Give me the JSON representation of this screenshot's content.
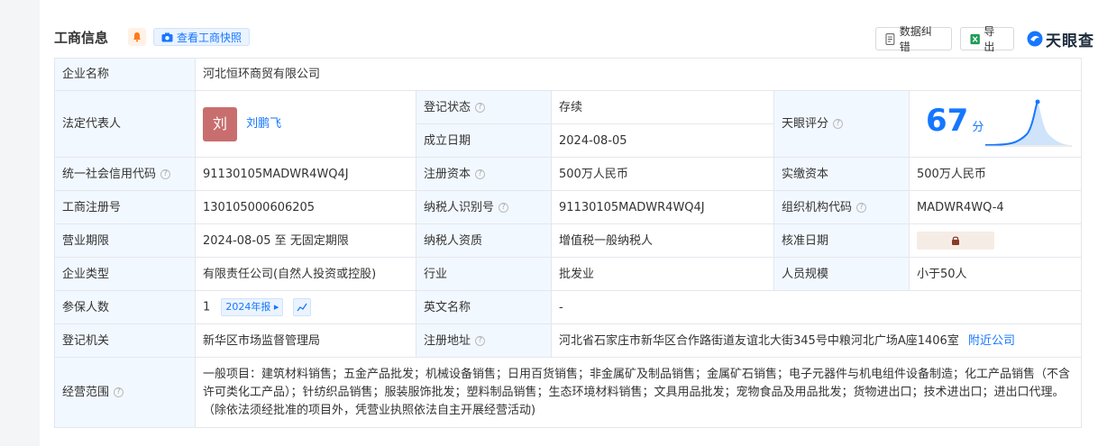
{
  "header": {
    "title": "工商信息",
    "snapshot_label": "查看工商快照",
    "correct_label": "数据纠错",
    "export_label": "导出",
    "brand": "天眼查",
    "accent": "#1677ff"
  },
  "rows": {
    "company_name_label": "企业名称",
    "company_name": "河北恒环商贸有限公司",
    "legal_rep_label": "法定代表人",
    "legal_rep_avatar": "刘",
    "legal_rep_name": "刘鹏飞",
    "reg_status_label": "登记状态",
    "reg_status": "存续",
    "found_date_label": "成立日期",
    "found_date": "2024-08-05",
    "score_label": "天眼评分",
    "score": "67",
    "score_unit": "分",
    "credit_code_label": "统一社会信用代码",
    "credit_code": "91130105MADWR4WQ4J",
    "reg_capital_label": "注册资本",
    "reg_capital": "500万人民币",
    "paid_capital_label": "实缴资本",
    "paid_capital": "500万人民币",
    "biz_reg_no_label": "工商注册号",
    "biz_reg_no": "130105000606205",
    "taxpayer_id_label": "纳税人识别号",
    "taxpayer_id": "91130105MADWR4WQ4J",
    "org_code_label": "组织机构代码",
    "org_code": "MADWR4WQ-4",
    "term_label": "营业期限",
    "term": "2024-08-05 至 无固定期限",
    "taxpayer_type_label": "纳税人资质",
    "taxpayer_type": "增值税一般纳税人",
    "approve_date_label": "核准日期",
    "company_type_label": "企业类型",
    "company_type": "有限责任公司(自然人投资或控股)",
    "industry_label": "行业",
    "industry": "批发业",
    "staff_size_label": "人员规模",
    "staff_size": "小于50人",
    "insured_label": "参保人数",
    "insured": "1",
    "insured_year_tag": "2024年报",
    "english_name_label": "英文名称",
    "english_name": "-",
    "authority_label": "登记机关",
    "authority": "新华区市场监督管理局",
    "address_label": "注册地址",
    "address": "河北省石家庄市新华区合作路街道友谊北大街345号中粮河北广场A座1406室",
    "nearby_label": "附近公司",
    "scope_label": "经营范围",
    "scope": "一般项目：建筑材料销售；五金产品批发；机械设备销售；日用百货销售；非金属矿及制品销售；金属矿石销售；电子元器件与机电组件设备制造；化工产品销售（不含许可类化工产品）；针纺织品销售；服装服饰批发；塑料制品销售；生态环境材料销售；文具用品批发；宠物食品及用品批发；货物进出口；技术进出口；进出口代理。（除依法须经批准的项目外，凭营业执照依法自主开展经营活动)"
  },
  "icons": {
    "bell": "bell-icon",
    "camera": "camera-icon",
    "doc": "doc-icon",
    "excel": "excel-icon",
    "help": "help-icon",
    "lock": "lock-icon",
    "trend": "trend-icon"
  }
}
